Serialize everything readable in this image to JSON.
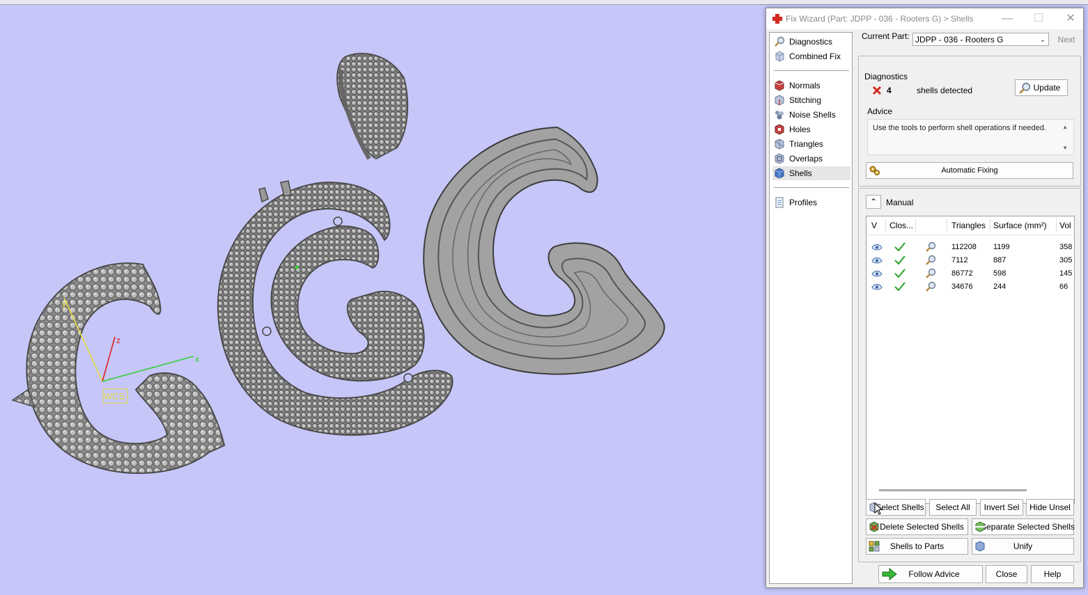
{
  "dialog": {
    "title": "Fix Wizard (Part: JDPP - 036 - Rooters G) > Shells",
    "min_glyph": "—",
    "max_glyph": "☐",
    "close_glyph": "✕"
  },
  "viewport": {
    "wcs_label": "WCS",
    "axis_x": "x",
    "axis_y": "y",
    "axis_z": "z",
    "background_color": "#c6c6f8"
  },
  "nav": {
    "items_top": [
      {
        "label": "Diagnostics",
        "icon": "magnifier-icon"
      },
      {
        "label": "Combined Fix",
        "icon": "combined-fix-icon"
      }
    ],
    "items_mid": [
      {
        "label": "Normals",
        "icon": "normals-icon"
      },
      {
        "label": "Stitching",
        "icon": "stitching-icon"
      },
      {
        "label": "Noise Shells",
        "icon": "noise-shells-icon"
      },
      {
        "label": "Holes",
        "icon": "holes-icon"
      },
      {
        "label": "Triangles",
        "icon": "triangles-icon"
      },
      {
        "label": "Overlaps",
        "icon": "overlaps-icon"
      },
      {
        "label": "Shells",
        "icon": "shells-icon",
        "selected": true
      }
    ],
    "items_bottom": [
      {
        "label": "Profiles",
        "icon": "profiles-icon"
      }
    ]
  },
  "current_part": {
    "label": "Current Part:",
    "value": "JDPP - 036 - Rooters G",
    "next_label": "Next"
  },
  "diagnostics": {
    "group_title": "Diagnostics",
    "count": "4",
    "count_text": "shells detected",
    "update_label": "Update",
    "advice_title": "Advice",
    "advice_text": "Use the tools to perform shell operations if needed.",
    "automatic_fixing_label": "Automatic Fixing"
  },
  "manual": {
    "label": "Manual",
    "columns": [
      "V",
      "Clos...",
      "",
      "Triangles",
      "Surface (mm²)",
      "Vol"
    ],
    "rows": [
      {
        "triangles": "112208",
        "surface": "1199",
        "volume": "358"
      },
      {
        "triangles": "7112",
        "surface": "887",
        "volume": "305"
      },
      {
        "triangles": "86772",
        "surface": "598",
        "volume": "145"
      },
      {
        "triangles": "34676",
        "surface": "244",
        "volume": "66"
      }
    ],
    "buttons": {
      "select_shells": "Select Shells",
      "select_all": "Select All",
      "invert_sel": "Invert Sel",
      "hide_unsel": "Hide Unsel",
      "delete_selected": "Delete Selected Shells",
      "separate_selected": "Separate Selected Shells",
      "shells_to_parts": "Shells to Parts",
      "unify": "Unify"
    }
  },
  "footer": {
    "follow_advice": "Follow Advice",
    "close": "Close",
    "help": "Help"
  },
  "colors": {
    "accent_red": "#d42a20",
    "check_green": "#2aa02a",
    "mesh_gray": "#9a9a9a"
  }
}
